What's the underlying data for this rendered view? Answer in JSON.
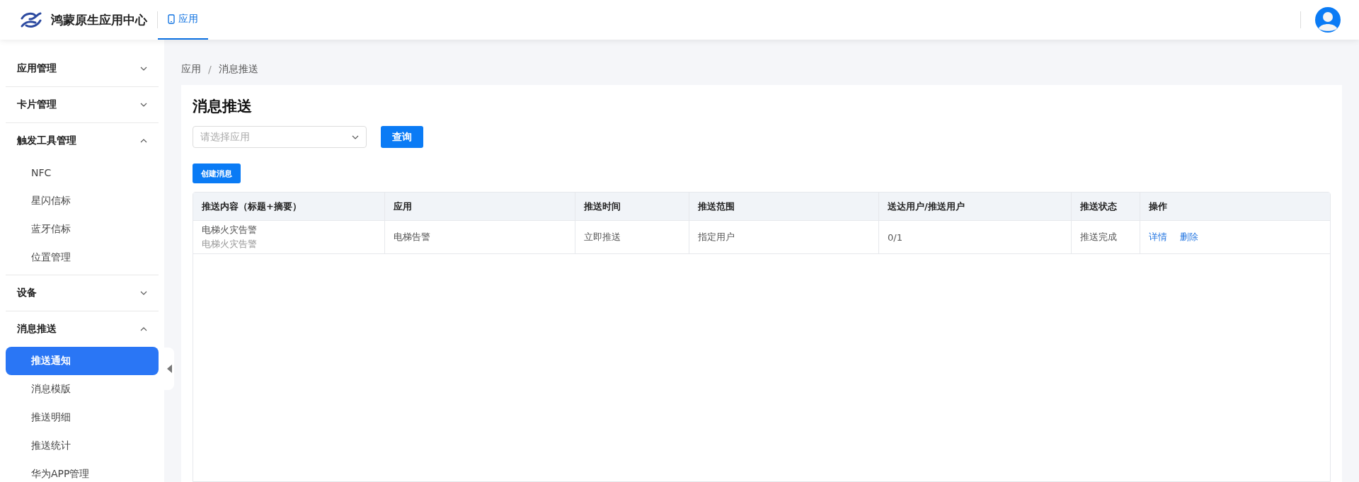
{
  "header": {
    "brand": "鸿蒙原生应用中心",
    "tabs": [
      {
        "label": "应用",
        "selected": true
      }
    ]
  },
  "sidebar": {
    "groups": [
      {
        "label": "应用管理",
        "expanded": false
      },
      {
        "label": "卡片管理",
        "expanded": false
      },
      {
        "label": "触发工具管理",
        "expanded": true,
        "items": [
          {
            "label": "NFC",
            "selected": false
          },
          {
            "label": "星闪信标",
            "selected": false
          },
          {
            "label": "蓝牙信标",
            "selected": false
          },
          {
            "label": "位置管理",
            "selected": false
          }
        ]
      },
      {
        "label": "设备",
        "expanded": false
      },
      {
        "label": "消息推送",
        "expanded": true,
        "items": [
          {
            "label": "推送通知",
            "selected": true
          },
          {
            "label": "消息模版",
            "selected": false
          },
          {
            "label": "推送明细",
            "selected": false
          },
          {
            "label": "推送统计",
            "selected": false
          },
          {
            "label": "华为APP管理",
            "selected": false
          }
        ]
      }
    ]
  },
  "breadcrumb": {
    "items": [
      "应用",
      "消息推送"
    ],
    "separator": "/"
  },
  "page_title": "消息推送",
  "app_select": {
    "placeholder": "请选择应用"
  },
  "query_button": "查询",
  "create_button": "创建消息",
  "table": {
    "columns": [
      "推送内容（标题+摘要）",
      "应用",
      "推送时间",
      "推送范围",
      "送达用户/推送用户",
      "推送状态",
      "操作"
    ],
    "rows": [
      {
        "title": "电梯火灾告警",
        "summary": "电梯火灾告警",
        "app": "电梯告警",
        "time": "立即推送",
        "scope": "指定用户",
        "delivered": "0/1",
        "status": "推送完成",
        "actions": [
          "详情",
          "删除"
        ]
      }
    ]
  }
}
